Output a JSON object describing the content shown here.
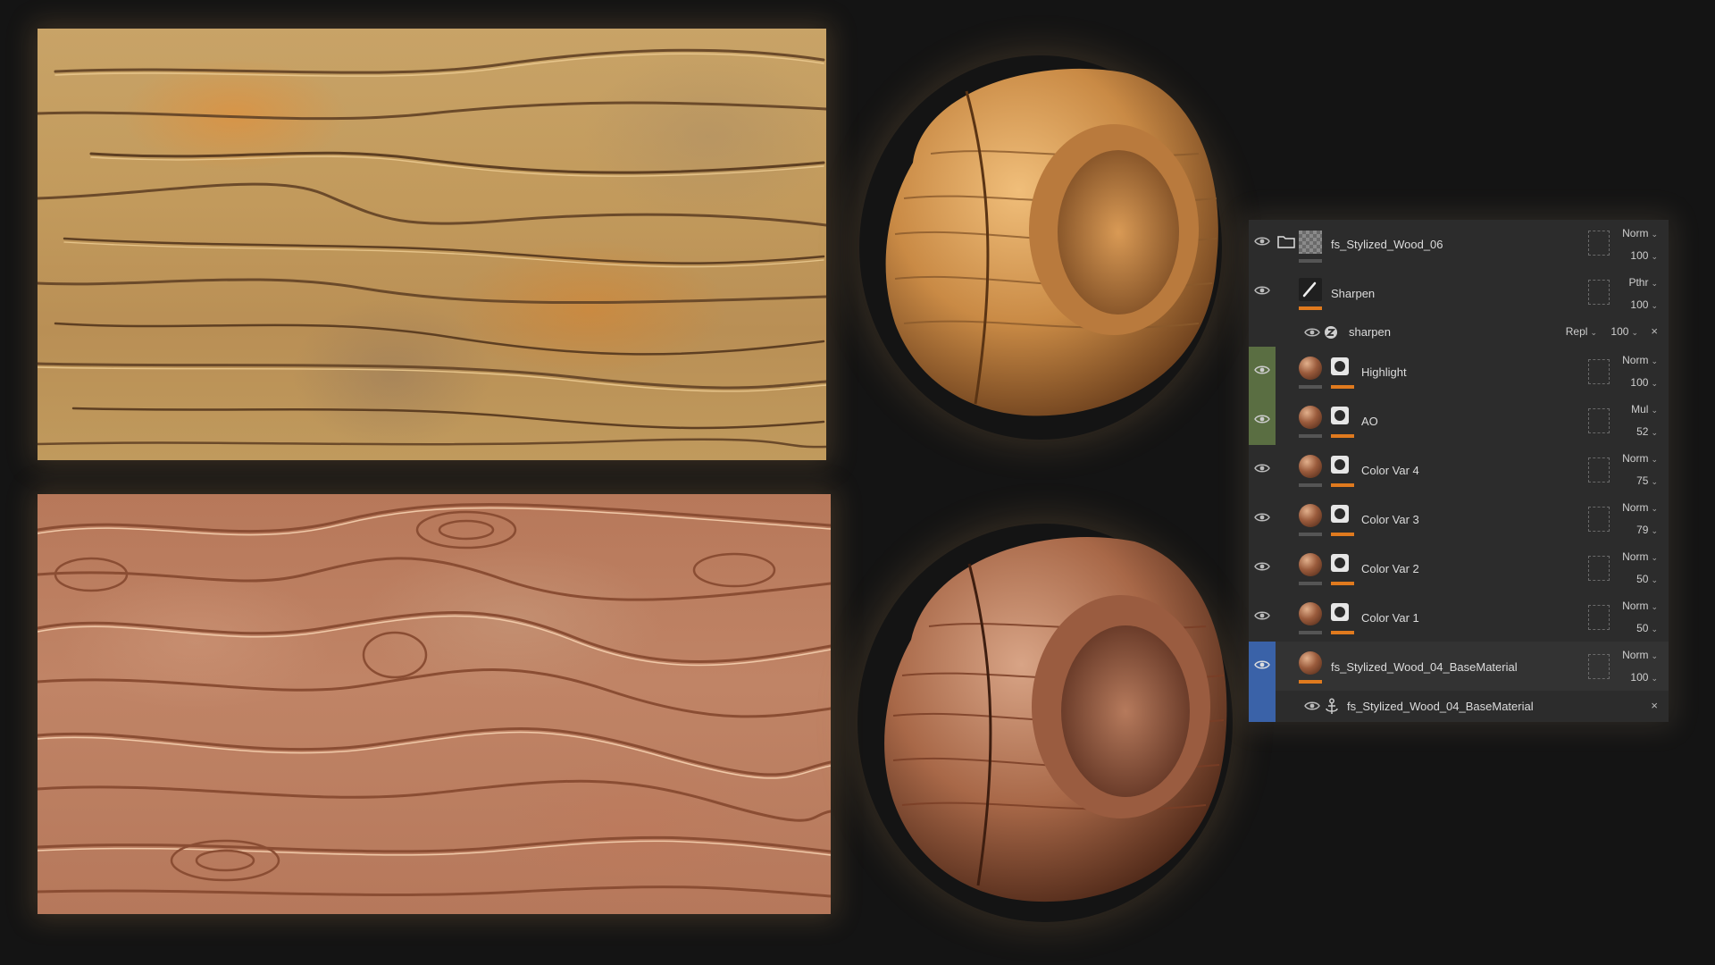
{
  "layers": [
    {
      "name": "fs_Stylized_Wood_06",
      "blend": "Norm",
      "opacity": "100",
      "type": "folder",
      "strip": "none"
    },
    {
      "name": "Sharpen",
      "blend": "Pthr",
      "opacity": "100",
      "type": "filter",
      "strip": "none"
    },
    {
      "name": "sharpen",
      "blend": "Repl",
      "opacity": "100",
      "type": "sub-filter",
      "strip": "none"
    },
    {
      "name": "Highlight",
      "blend": "Norm",
      "opacity": "100",
      "type": "fill",
      "strip": "green"
    },
    {
      "name": "AO",
      "blend": "Mul",
      "opacity": "52",
      "type": "fill",
      "strip": "green"
    },
    {
      "name": "Color Var 4",
      "blend": "Norm",
      "opacity": "75",
      "type": "fill",
      "strip": "none"
    },
    {
      "name": "Color Var 3",
      "blend": "Norm",
      "opacity": "79",
      "type": "fill",
      "strip": "none"
    },
    {
      "name": "Color Var 2",
      "blend": "Norm",
      "opacity": "50",
      "type": "fill",
      "strip": "none"
    },
    {
      "name": "Color Var 1",
      "blend": "Norm",
      "opacity": "50",
      "type": "fill",
      "strip": "none"
    },
    {
      "name": "fs_Stylized_Wood_04_BaseMaterial",
      "blend": "Norm",
      "opacity": "100",
      "type": "material",
      "strip": "blue"
    },
    {
      "name": "fs_Stylized_Wood_04_BaseMaterial",
      "type": "anchor",
      "strip": "blue"
    }
  ],
  "colors": {
    "accent_orange": "#e07a1e",
    "strip_green": "#5a6e42",
    "strip_blue": "#3a62a8",
    "panel_bg": "#2a2a2a",
    "page_bg": "#141414"
  },
  "icons": {
    "visibility": "eye-icon",
    "folder": "folder-icon",
    "brush": "brush-icon",
    "filter": "filter-icon",
    "anchor": "anchor-icon",
    "close": "close-icon",
    "chevron": "chevron-down-icon"
  }
}
